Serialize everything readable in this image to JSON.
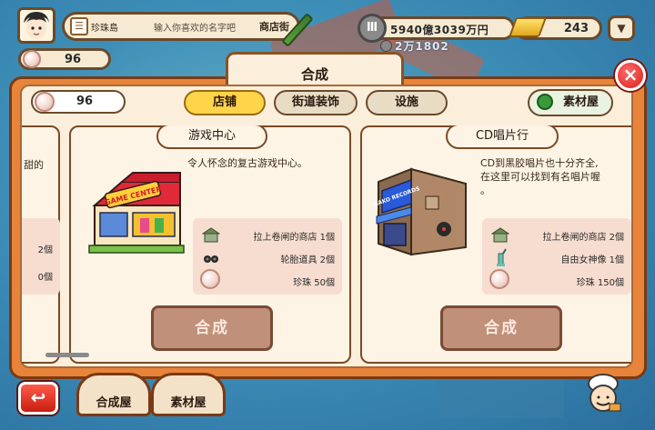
{
  "hud": {
    "island_name": "珍珠島",
    "name_placeholder": "输入你喜欢的名字吧",
    "street_label": "商店街",
    "money": "5940億3039万円",
    "money_sub": "2万1802",
    "gold": "243",
    "pearls": "96"
  },
  "panel": {
    "title": "合成",
    "title_echo": "万1802",
    "pearls": "96",
    "tabs": [
      {
        "label": "店铺",
        "active": true
      },
      {
        "label": "街道装饰",
        "active": false
      },
      {
        "label": "设施",
        "active": false
      }
    ],
    "materials_tab": "素材屋",
    "close_label": "×"
  },
  "cards": {
    "partial": {
      "desc_fragment": "甜的",
      "qty1": "2個",
      "qty2": "0個"
    },
    "game_center": {
      "title": "游戏中心",
      "description": "令人怀念的复古游戏中心。",
      "sign": "GAME CENTER",
      "materials": [
        "拉上卷闸的商店 1個",
        "轮胎道具 2個",
        "珍珠 50個"
      ],
      "combine_label": "合成"
    },
    "cd_shop": {
      "title": "CD唱片行",
      "description_lines": [
        "CD到黑胶唱片也十分齐全,",
        "在这里可以找到有名唱片喔",
        "。"
      ],
      "sign": "NAKO RECORDS",
      "materials": [
        "拉上卷闸的商店 2個",
        "自由女神像 1個",
        "珍珠 150個"
      ],
      "combine_label": "合成"
    }
  },
  "bottom": {
    "back": "↩",
    "combine_house": "合成屋",
    "material_house": "素材屋"
  },
  "colors": {
    "panel_orange": "#e8843a",
    "tab_active": "#ffd44a",
    "button_disabled": "#c0907a",
    "close_red": "#d8201a"
  }
}
